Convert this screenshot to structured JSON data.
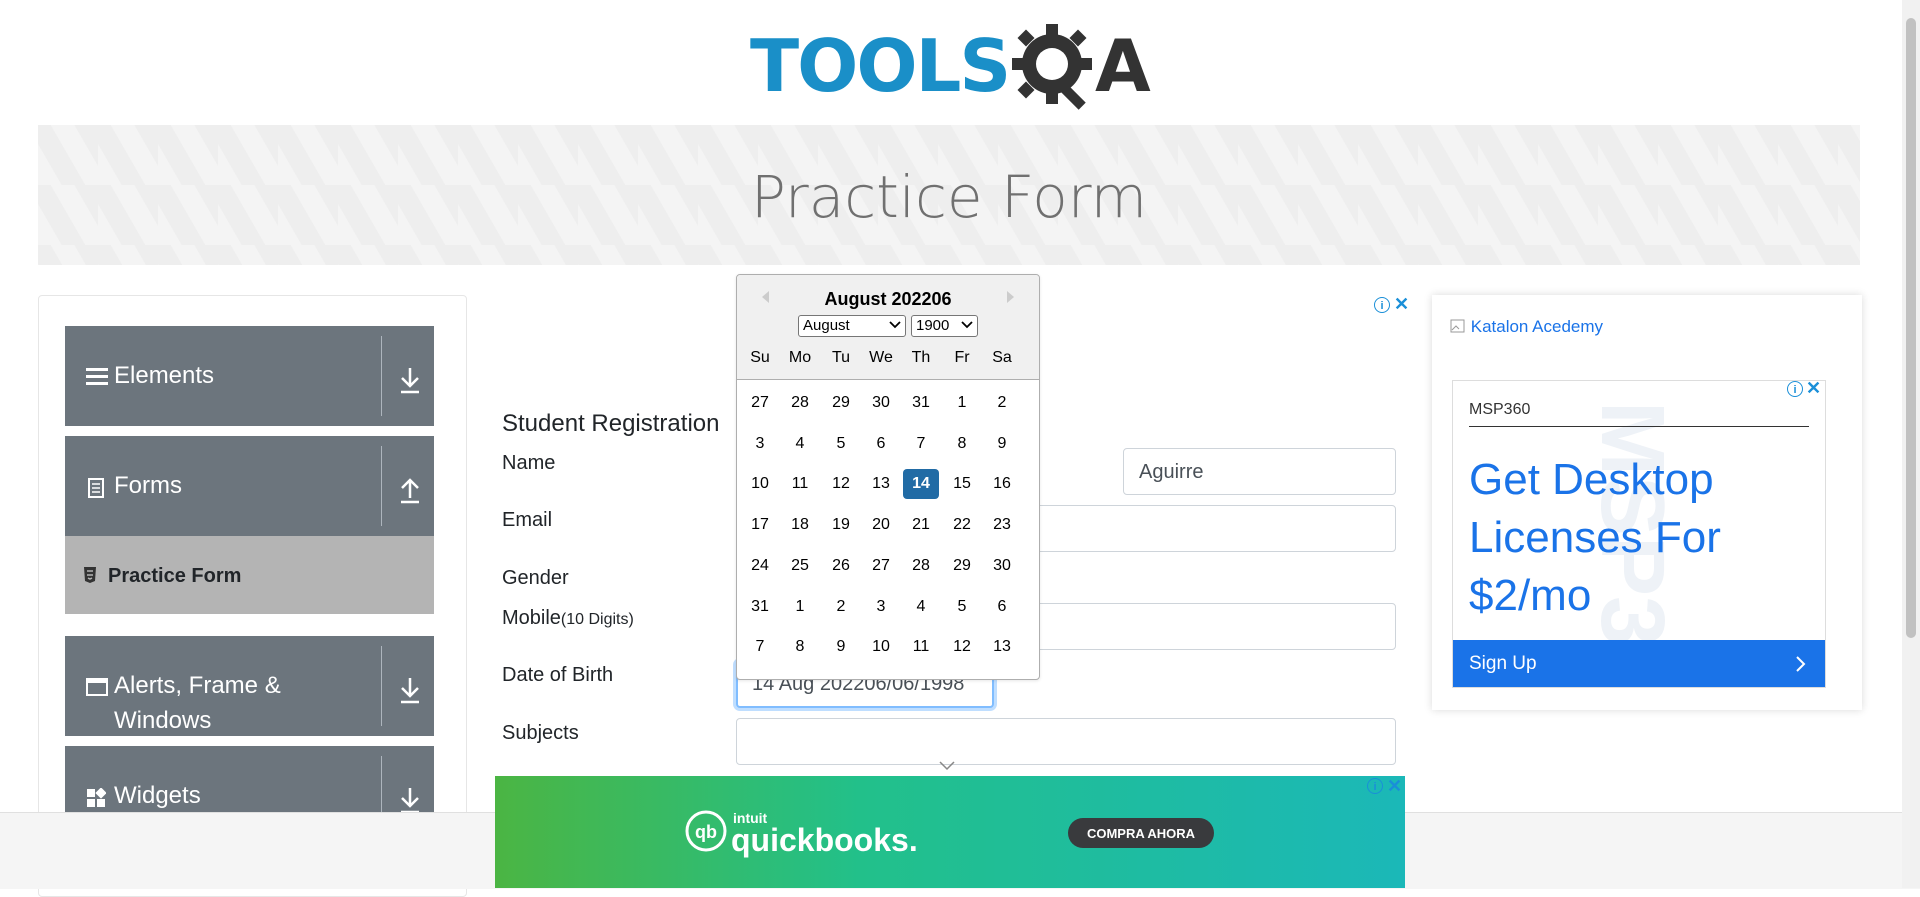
{
  "logo": {
    "text_left": "TOOLS",
    "text_right": "A"
  },
  "banner": {
    "title": "Practice Form"
  },
  "sidebar": {
    "groups": [
      {
        "label": "Elements"
      },
      {
        "label": "Forms"
      },
      {
        "label": "Alerts, Frame &",
        "label2": "Windows"
      },
      {
        "label": "Widgets"
      }
    ],
    "active_item": "Practice Form"
  },
  "form": {
    "heading": "Student Registration",
    "name_label": "Name",
    "last_name_value": "Aguirre",
    "email_label": "Email",
    "gender_label": "Gender",
    "mobile_label": "Mobile",
    "mobile_hint": "(10 Digits)",
    "dob_label": "Date of Birth",
    "dob_value": "14 Aug 202206/06/1998",
    "subjects_label": "Subjects"
  },
  "calendar": {
    "title": "August 202206",
    "month_select": "August",
    "year_select": "1900",
    "day_names": [
      "Su",
      "Mo",
      "Tu",
      "We",
      "Th",
      "Fr",
      "Sa"
    ],
    "weeks": [
      [
        "27",
        "28",
        "29",
        "30",
        "31",
        "1",
        "2"
      ],
      [
        "3",
        "4",
        "5",
        "6",
        "7",
        "8",
        "9"
      ],
      [
        "10",
        "11",
        "12",
        "13",
        "14",
        "15",
        "16"
      ],
      [
        "17",
        "18",
        "19",
        "20",
        "21",
        "22",
        "23"
      ],
      [
        "24",
        "25",
        "26",
        "27",
        "28",
        "29",
        "30"
      ],
      [
        "31",
        "1",
        "2",
        "3",
        "4",
        "5",
        "6"
      ],
      [
        "7",
        "8",
        "9",
        "10",
        "11",
        "12",
        "13"
      ]
    ],
    "selected_day": "14"
  },
  "ad_right": {
    "image_alt": "Katalon Acedemy",
    "brand": "MSP360",
    "headline": "Get Desktop Licenses For $2/mo",
    "cta": "Sign Up"
  },
  "ad_bottom": {
    "brand_top": "intuit",
    "brand": "quickbooks.",
    "cta": "COMPRA AHORA"
  },
  "colors": {
    "accent": "#216ba5",
    "sidebar": "#6c757d",
    "brand_blue": "#1a8fc8",
    "ad_blue": "#1a73e8"
  }
}
